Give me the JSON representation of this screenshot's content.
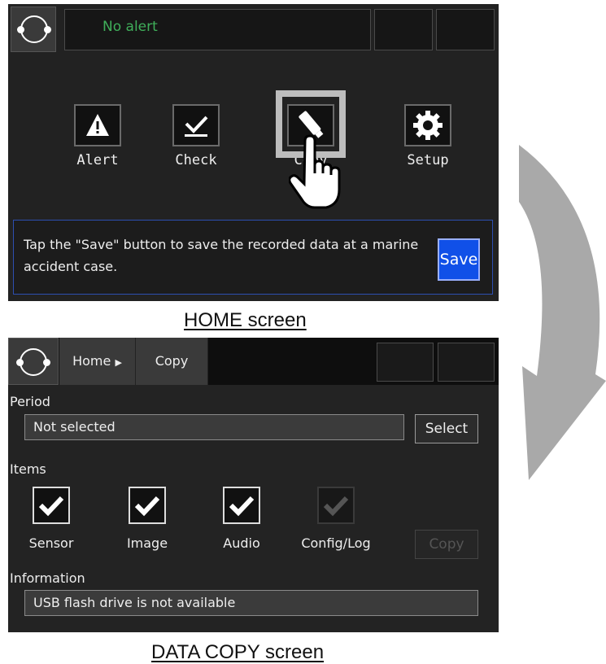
{
  "home": {
    "status_text": "No alert",
    "menu": [
      {
        "label": "Alert",
        "icon": "warning-icon"
      },
      {
        "label": "Check",
        "icon": "checkmark-icon"
      },
      {
        "label": "Copy",
        "icon": "usb-drive-icon"
      },
      {
        "label": "Setup",
        "icon": "gear-icon"
      }
    ],
    "info_text": "Tap the \"Save\" button to save the recorded data at a marine accident case.",
    "save_label": "Save",
    "caption": "HOME screen"
  },
  "copy_screen": {
    "breadcrumb": {
      "home": "Home",
      "current": "Copy"
    },
    "period": {
      "label": "Period",
      "value": "Not selected",
      "select_label": "Select"
    },
    "items": {
      "label": "Items",
      "checkboxes": [
        {
          "label": "Sensor",
          "checked": true,
          "enabled": true
        },
        {
          "label": "Image",
          "checked": true,
          "enabled": true
        },
        {
          "label": "Audio",
          "checked": true,
          "enabled": true
        },
        {
          "label": "Config/Log",
          "checked": true,
          "enabled": false
        }
      ],
      "copy_label": "Copy"
    },
    "information": {
      "label": "Information",
      "value": "USB flash drive is not available"
    },
    "caption": "DATA COPY screen"
  },
  "colors": {
    "accent_blue": "#1050e8",
    "status_green": "#3fae5a",
    "panel_border": "#2d4fb0"
  }
}
